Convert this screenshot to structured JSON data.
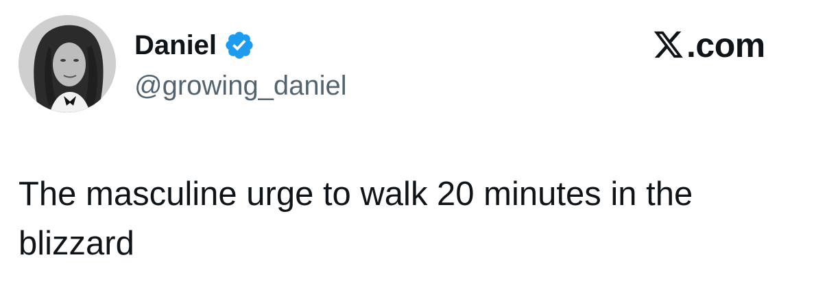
{
  "author": {
    "display_name": "Daniel",
    "handle": "@growing_daniel",
    "verified_icon": "verified-badge-icon",
    "verified_color": "#1d9bf0",
    "avatar_icon": "profile-photo-icon"
  },
  "brand": {
    "logo_icon": "x-logo-icon",
    "text": ".com"
  },
  "tweet": {
    "text": "The masculine urge to walk 20 minutes in the blizzard"
  },
  "colors": {
    "text": "#0f1419",
    "secondary": "#536471",
    "background": "#ffffff"
  }
}
